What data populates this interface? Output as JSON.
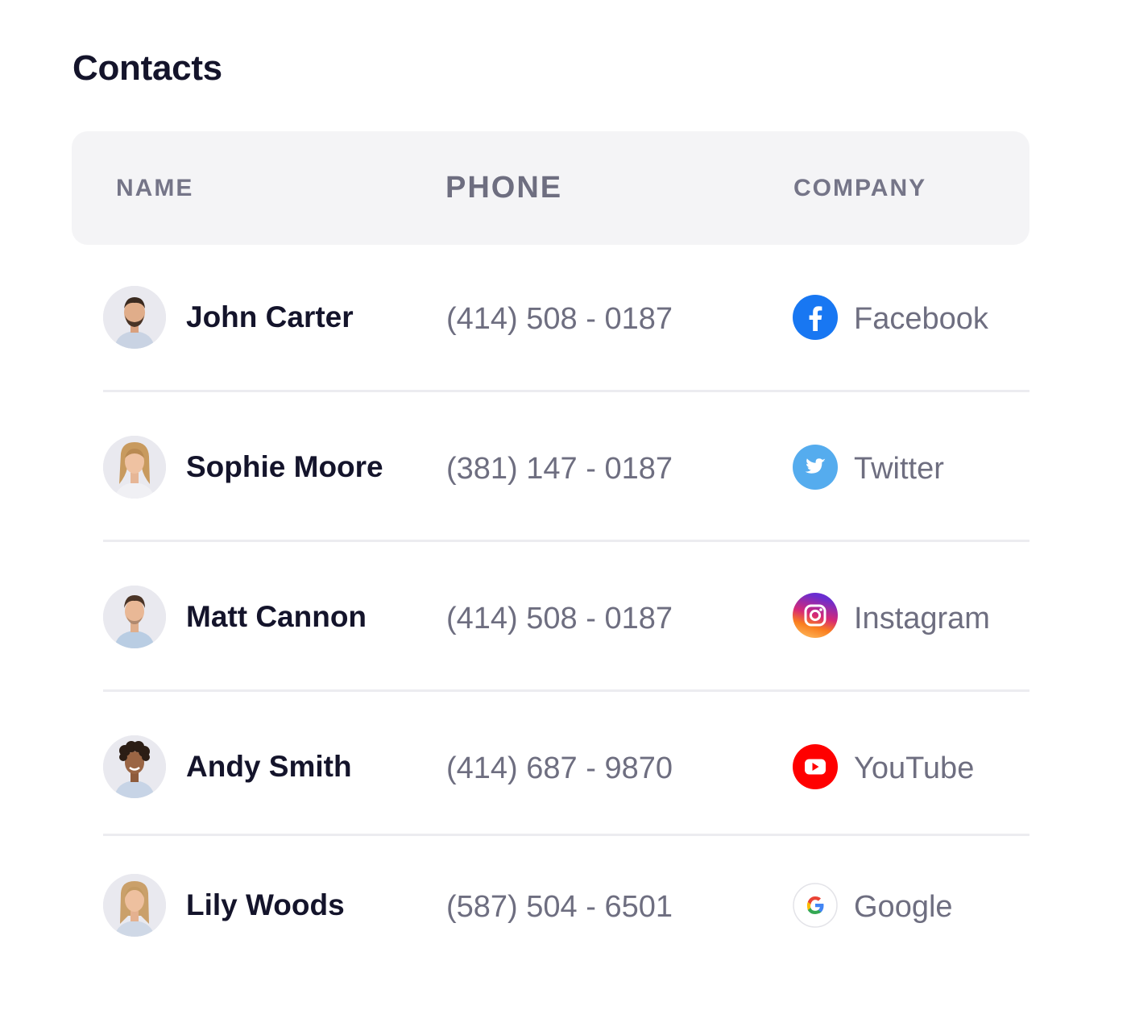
{
  "page": {
    "title": "Contacts"
  },
  "table": {
    "headers": {
      "name": "NAME",
      "phone": "PHONE",
      "company": "COMPANY"
    },
    "rows": [
      {
        "name": "John Carter",
        "phone": "(414) 508 - 0187",
        "company": "Facebook",
        "company_icon": "facebook-icon",
        "brand_color": "#1877f2"
      },
      {
        "name": "Sophie Moore",
        "phone": "(381) 147 - 0187",
        "company": "Twitter",
        "company_icon": "twitter-icon",
        "brand_color": "#55acee"
      },
      {
        "name": "Matt Cannon",
        "phone": "(414) 508 - 0187",
        "company": "Instagram",
        "company_icon": "instagram-icon",
        "brand_color": "#c13584"
      },
      {
        "name": "Andy Smith",
        "phone": "(414) 687 - 9870",
        "company": "YouTube",
        "company_icon": "youtube-icon",
        "brand_color": "#ff0000"
      },
      {
        "name": "Lily Woods",
        "phone": "(587) 504 - 6501",
        "company": "Google",
        "company_icon": "google-icon",
        "brand_color": "#4285f4"
      }
    ]
  },
  "colors": {
    "title": "#14142b",
    "header_bg": "#f4f4f6",
    "header_text": "#757588",
    "muted_text": "#6e6e80",
    "divider": "#ececf0"
  }
}
